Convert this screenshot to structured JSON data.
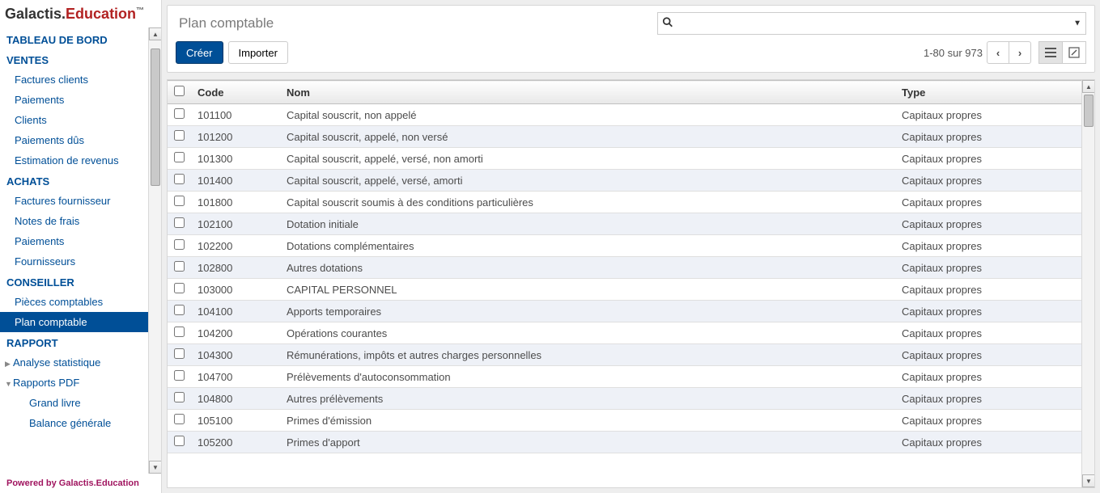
{
  "logo": {
    "a": "Galactis.",
    "b": "Education",
    "tm": "™"
  },
  "sidebar": {
    "headings": {
      "dashboard": "TABLEAU DE BORD",
      "ventes": "VENTES",
      "achats": "ACHATS",
      "conseiller": "CONSEILLER",
      "rapport": "RAPPORT"
    },
    "ventes": [
      "Factures clients",
      "Paiements",
      "Clients",
      "Paiements dûs",
      "Estimation de revenus"
    ],
    "achats": [
      "Factures fournisseur",
      "Notes de frais",
      "Paiements",
      "Fournisseurs"
    ],
    "conseiller": [
      "Pièces comptables",
      "Plan comptable"
    ],
    "rapport": [
      "Analyse statistique",
      "Rapports PDF"
    ],
    "rapport_subs": [
      "Grand livre",
      "Balance générale"
    ],
    "active_index": 1,
    "footer": "Powered by Galactis.Education"
  },
  "header": {
    "breadcrumb": "Plan comptable",
    "create_label": "Créer",
    "import_label": "Importer",
    "search_placeholder": "",
    "pager": "1-80 sur 973"
  },
  "table": {
    "columns": {
      "code": "Code",
      "name": "Nom",
      "type": "Type"
    },
    "rows": [
      {
        "code": "101100",
        "name": "Capital souscrit, non appelé",
        "type": "Capitaux propres"
      },
      {
        "code": "101200",
        "name": "Capital souscrit, appelé, non versé",
        "type": "Capitaux propres"
      },
      {
        "code": "101300",
        "name": "Capital souscrit, appelé, versé, non amorti",
        "type": "Capitaux propres"
      },
      {
        "code": "101400",
        "name": "Capital souscrit, appelé, versé, amorti",
        "type": "Capitaux propres"
      },
      {
        "code": "101800",
        "name": "Capital souscrit soumis à des conditions particulières",
        "type": "Capitaux propres"
      },
      {
        "code": "102100",
        "name": "Dotation initiale",
        "type": "Capitaux propres"
      },
      {
        "code": "102200",
        "name": "Dotations complémentaires",
        "type": "Capitaux propres"
      },
      {
        "code": "102800",
        "name": "Autres dotations",
        "type": "Capitaux propres"
      },
      {
        "code": "103000",
        "name": "CAPITAL PERSONNEL",
        "type": "Capitaux propres"
      },
      {
        "code": "104100",
        "name": "Apports temporaires",
        "type": "Capitaux propres"
      },
      {
        "code": "104200",
        "name": "Opérations courantes",
        "type": "Capitaux propres"
      },
      {
        "code": "104300",
        "name": "Rémunérations, impôts et autres charges personnelles",
        "type": "Capitaux propres"
      },
      {
        "code": "104700",
        "name": "Prélèvements d'autoconsommation",
        "type": "Capitaux propres"
      },
      {
        "code": "104800",
        "name": "Autres prélèvements",
        "type": "Capitaux propres"
      },
      {
        "code": "105100",
        "name": "Primes d'émission",
        "type": "Capitaux propres"
      },
      {
        "code": "105200",
        "name": "Primes d'apport",
        "type": "Capitaux propres"
      }
    ]
  }
}
